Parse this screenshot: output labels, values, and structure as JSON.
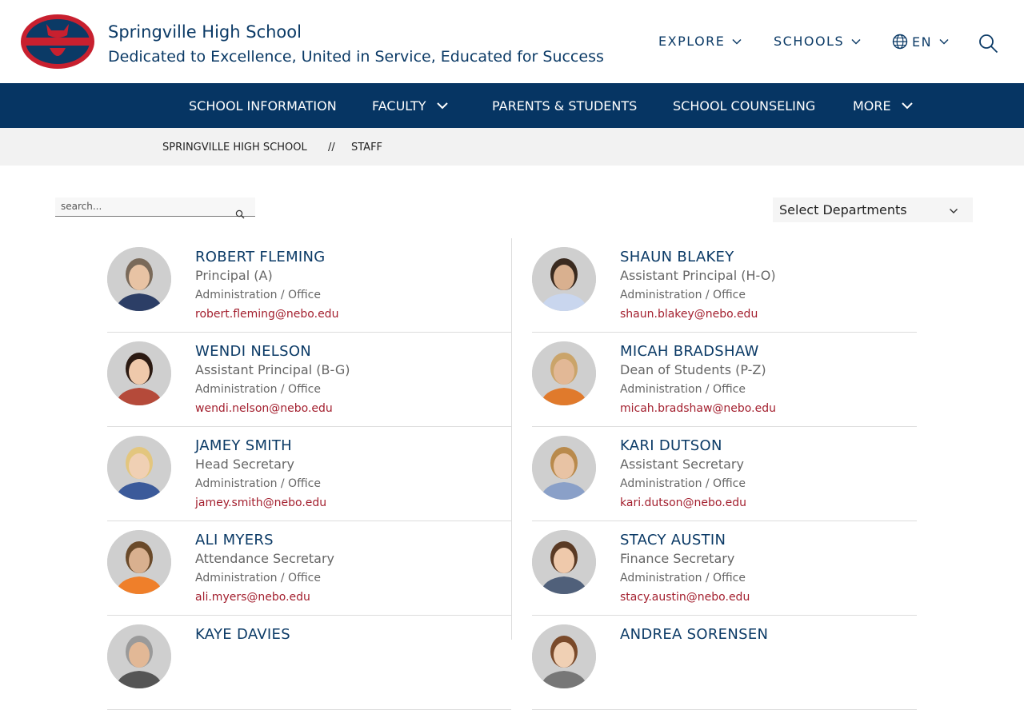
{
  "header": {
    "school_name": "Springville High School",
    "tagline": "Dedicated to Excellence, United in Service, Educated for Success",
    "nav": {
      "explore": "EXPLORE",
      "schools": "SCHOOLS",
      "language": "EN"
    }
  },
  "main_nav": [
    "SCHOOL INFORMATION",
    "FACULTY",
    "PARENTS & STUDENTS",
    "SCHOOL COUNSELING",
    "MORE"
  ],
  "breadcrumb": {
    "home": "SPRINGVILLE HIGH SCHOOL",
    "separator": "//",
    "current": "STAFF"
  },
  "search": {
    "placeholder": "search..."
  },
  "department_select": {
    "selected": "Select Departments"
  },
  "colors": {
    "navy": "#063563",
    "accent_red": "#a31f2e",
    "logo_red": "#c8202f"
  },
  "staff": [
    {
      "name": "ROBERT FLEMING",
      "title": "Principal (A)",
      "department": "Administration / Office",
      "email": "robert.fleming@nebo.edu"
    },
    {
      "name": "SHAUN BLAKEY",
      "title": "Assistant Principal (H-O)",
      "department": "Administration / Office",
      "email": "shaun.blakey@nebo.edu"
    },
    {
      "name": "WENDI NELSON",
      "title": "Assistant Principal (B-G)",
      "department": "Administration / Office",
      "email": "wendi.nelson@nebo.edu"
    },
    {
      "name": "MICAH BRADSHAW",
      "title": "Dean of Students (P-Z)",
      "department": "Administration / Office",
      "email": "micah.bradshaw@nebo.edu"
    },
    {
      "name": "JAMEY SMITH",
      "title": "Head Secretary",
      "department": "Administration / Office",
      "email": "jamey.smith@nebo.edu"
    },
    {
      "name": "KARI DUTSON",
      "title": "Assistant Secretary",
      "department": "Administration / Office",
      "email": "kari.dutson@nebo.edu"
    },
    {
      "name": "ALI MYERS",
      "title": "Attendance Secretary",
      "department": "Administration / Office",
      "email": "ali.myers@nebo.edu"
    },
    {
      "name": "STACY AUSTIN",
      "title": "Finance Secretary",
      "department": "Administration / Office",
      "email": "stacy.austin@nebo.edu"
    },
    {
      "name": "KAYE DAVIES",
      "title": "",
      "department": "",
      "email": ""
    },
    {
      "name": "ANDREA SORENSEN",
      "title": "",
      "department": "",
      "email": ""
    }
  ]
}
